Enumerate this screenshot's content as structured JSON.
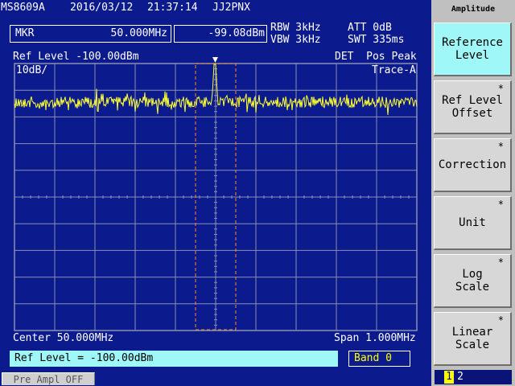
{
  "header": {
    "model": "MS8609A",
    "date": "2016/03/12",
    "time": "21:37:14",
    "title": "JJ2PNX"
  },
  "marker": {
    "label": "MKR",
    "frequency": "50.000MHz",
    "level": "-99.08dBm"
  },
  "settings": {
    "rbw": "RBW 3kHz",
    "vbw": "VBW 3kHz",
    "att": "ATT 0dB",
    "swt": "SWT 335ms"
  },
  "graticule": {
    "ref_level": "Ref Level -100.00dBm",
    "detector": "DET  Pos Peak",
    "scale": "10dB/",
    "trace": "Trace-A",
    "center": "Center 50.000MHz",
    "span": "Span 1.000MHz"
  },
  "status": {
    "entry": "Ref Level = -100.00dBm",
    "band": "Band 0",
    "preamp": "Pre Ampl OFF"
  },
  "softkeys": {
    "panel_title": "Amplitude",
    "keys": [
      {
        "label": "Reference\nLevel",
        "star": ""
      },
      {
        "label": "Ref Level\nOffset",
        "star": "*"
      },
      {
        "label": "Correction",
        "star": "*"
      },
      {
        "label": "Unit",
        "star": "*"
      },
      {
        "label": "Log\nScale",
        "star": "*"
      },
      {
        "label": "Linear\nScale",
        "star": "*"
      }
    ],
    "page_current": "1",
    "page_other": "2"
  },
  "colors": {
    "background": "#0b1a8c",
    "trace": "#ffff33",
    "graticule": "#8a8fb5",
    "marker_window": "#ff8c1a",
    "active_softkey": "#9ff7f7",
    "entry_field": "#9ff7f7",
    "band_field_text": "#ffff00",
    "page_highlight": "#ffff00"
  }
}
